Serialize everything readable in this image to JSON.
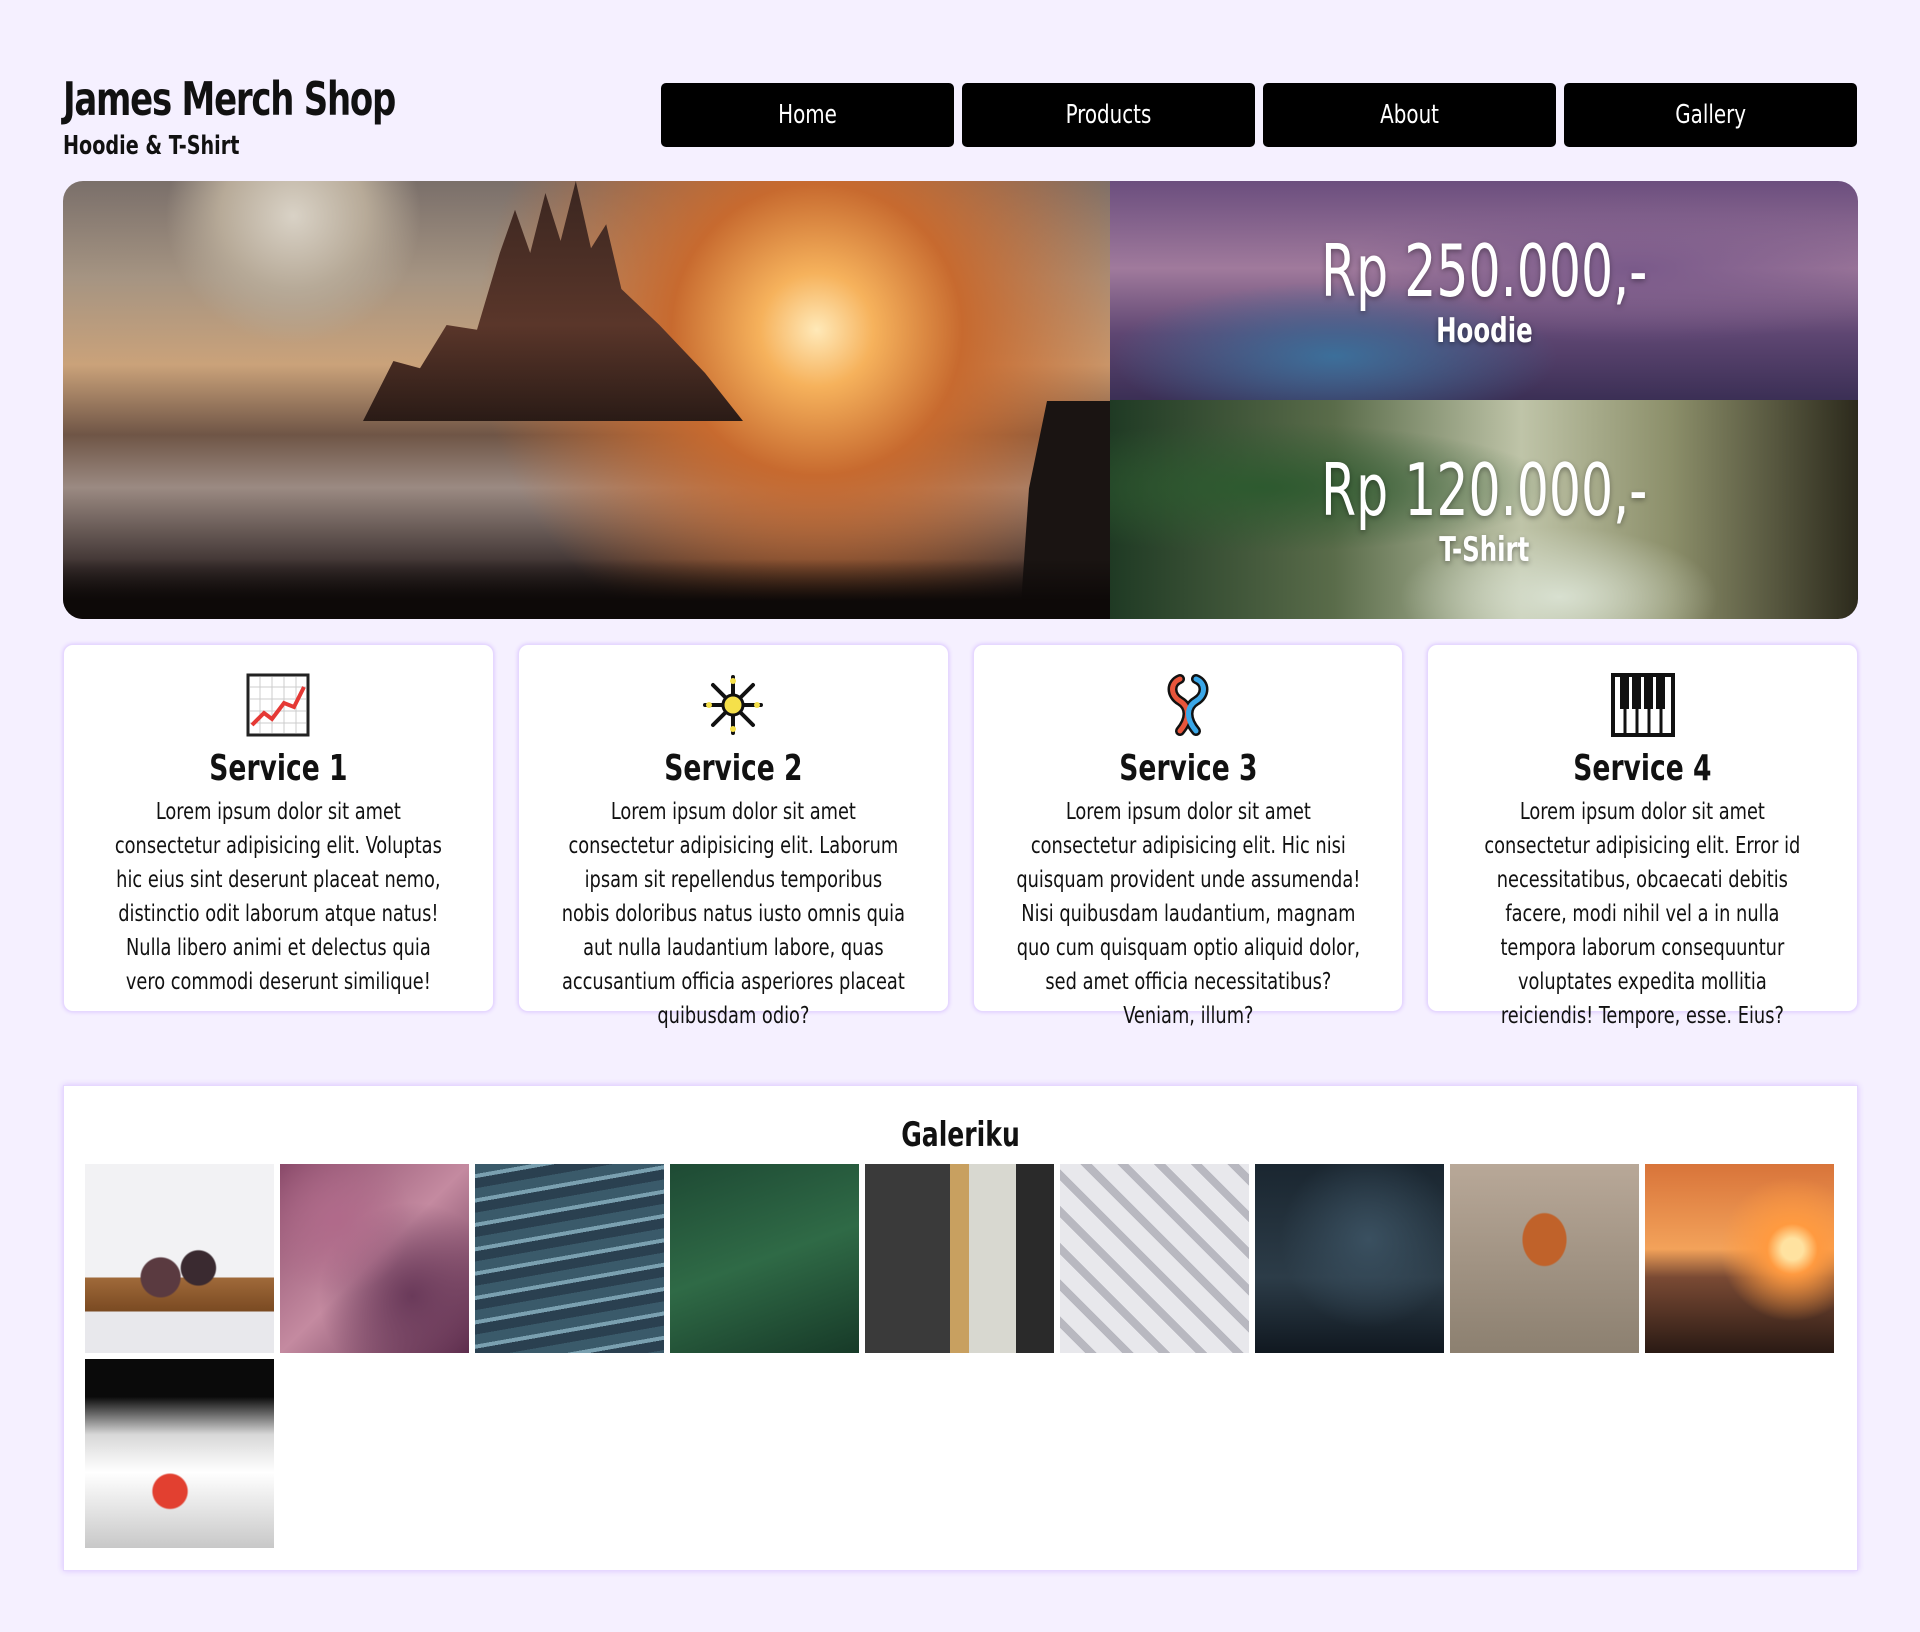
{
  "brand": {
    "title": "James Merch Shop",
    "subtitle": "Hoodie & T-Shirt"
  },
  "nav": {
    "items": [
      {
        "label": "Home"
      },
      {
        "label": "Products"
      },
      {
        "label": "About"
      },
      {
        "label": "Gallery"
      }
    ]
  },
  "hero": {
    "offers": [
      {
        "price": "Rp 250.000,-",
        "product": "Hoodie"
      },
      {
        "price": "Rp 120.000,-",
        "product": "T-Shirt"
      }
    ]
  },
  "services": [
    {
      "icon": "chart-increasing-icon",
      "title": "Service 1",
      "text": "Lorem ipsum dolor sit amet consectetur adipisicing elit. Voluptas hic eius sint deserunt placeat nemo, distinctio odit laborum atque natus! Nulla libero animi et delectus quia vero commodi deserunt similique!"
    },
    {
      "icon": "sparkler-icon",
      "title": "Service 2",
      "text": "Lorem ipsum dolor sit amet consectetur adipisicing elit. Laborum ipsam sit repellendus temporibus nobis doloribus natus iusto omnis quia aut nulla laudantium labore, quas accusantium officia asperiores placeat quibusdam odio?"
    },
    {
      "icon": "knot-icon",
      "title": "Service 3",
      "text": "Lorem ipsum dolor sit amet consectetur adipisicing elit. Hic nisi quisquam provident unde assumenda! Nisi quibusdam laudantium, magnam quo cum quisquam optio aliquid dolor, sed amet officia necessitatibus? Veniam, illum?"
    },
    {
      "icon": "piano-keys-icon",
      "title": "Service 4",
      "text": "Lorem ipsum dolor sit amet consectetur adipisicing elit. Error id necessitatibus, obcaecati debitis facere, modi nihil vel a in nulla tempora laborum consequuntur voluptates expedita mollitia reiciendis! Tempore, esse. Eius?"
    }
  ],
  "gallery": {
    "title": "Galeriku"
  }
}
